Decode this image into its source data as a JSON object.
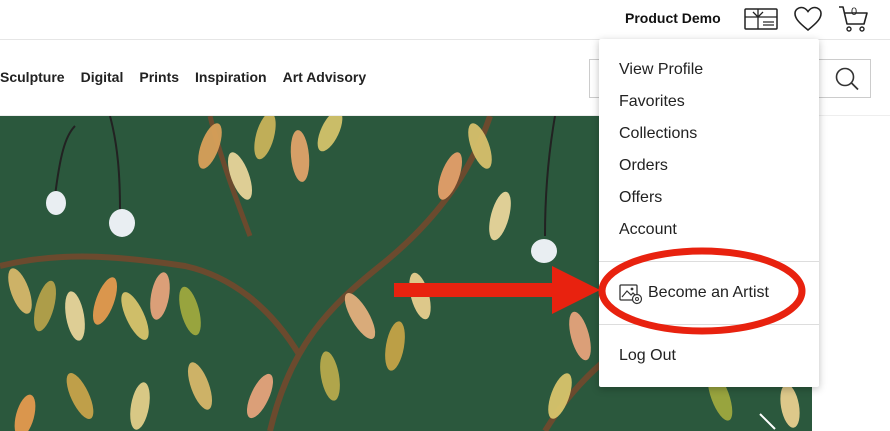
{
  "header": {
    "user_name": "Product Demo",
    "cart_count": "0",
    "icons": [
      "gift-card-icon",
      "heart-icon",
      "cart-icon"
    ]
  },
  "nav": {
    "links": [
      "Sculpture",
      "Digital",
      "Prints",
      "Inspiration",
      "Art Advisory"
    ],
    "search_icon": "search-icon"
  },
  "dropdown": {
    "items": [
      "View Profile",
      "Favorites",
      "Collections",
      "Orders",
      "Offers",
      "Account"
    ],
    "become_artist": "Become an Artist",
    "logout": "Log Out"
  },
  "annotation": {
    "arrow_color": "#e8220f",
    "ellipse_color": "#e8220f"
  }
}
